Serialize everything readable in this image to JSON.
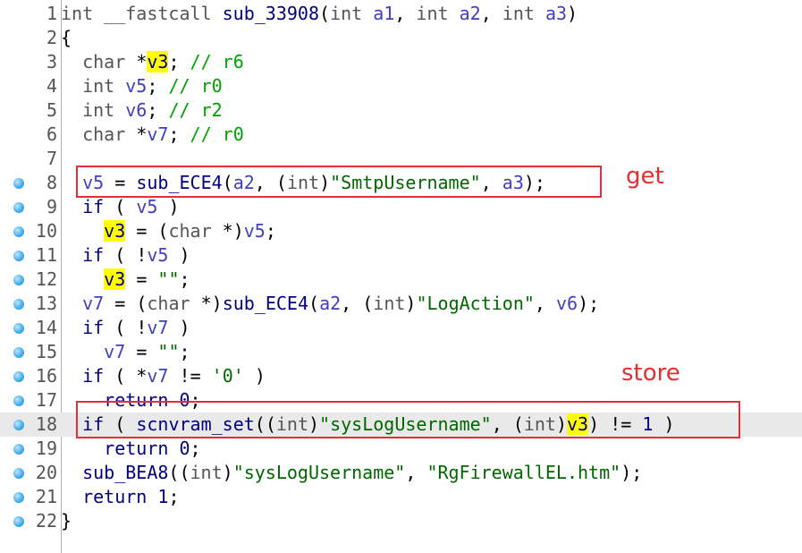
{
  "editor": {
    "lines": [
      {
        "num": "1",
        "bp": false,
        "hl": false,
        "code": "int __fastcall sub_33908(int a1, int a2, int a3)"
      },
      {
        "num": "2",
        "bp": false,
        "hl": false,
        "code": "{"
      },
      {
        "num": "3",
        "bp": false,
        "hl": false,
        "code": "  char *v3; // r6"
      },
      {
        "num": "4",
        "bp": false,
        "hl": false,
        "code": "  int v5; // r0"
      },
      {
        "num": "5",
        "bp": false,
        "hl": false,
        "code": "  int v6; // r2"
      },
      {
        "num": "6",
        "bp": false,
        "hl": false,
        "code": "  char *v7; // r0"
      },
      {
        "num": "7",
        "bp": false,
        "hl": false,
        "code": ""
      },
      {
        "num": "8",
        "bp": true,
        "hl": false,
        "code": "  v5 = sub_ECE4(a2, (int)\"SmtpUsername\", a3);"
      },
      {
        "num": "9",
        "bp": true,
        "hl": false,
        "code": "  if ( v5 )"
      },
      {
        "num": "10",
        "bp": true,
        "hl": false,
        "code": "    v3 = (char *)v5;"
      },
      {
        "num": "11",
        "bp": true,
        "hl": false,
        "code": "  if ( !v5 )"
      },
      {
        "num": "12",
        "bp": true,
        "hl": false,
        "code": "    v3 = \"\";"
      },
      {
        "num": "13",
        "bp": true,
        "hl": false,
        "code": "  v7 = (char *)sub_ECE4(a2, (int)\"LogAction\", v6);"
      },
      {
        "num": "14",
        "bp": true,
        "hl": false,
        "code": "  if ( !v7 )"
      },
      {
        "num": "15",
        "bp": true,
        "hl": false,
        "code": "    v7 = \"\";"
      },
      {
        "num": "16",
        "bp": true,
        "hl": false,
        "code": "  if ( *v7 != '0' )"
      },
      {
        "num": "17",
        "bp": true,
        "hl": false,
        "code": "    return 0;"
      },
      {
        "num": "18",
        "bp": true,
        "hl": true,
        "code": "  if ( scnvram_set((int)\"sysLogUsername\", (int)v3) != 1 )"
      },
      {
        "num": "19",
        "bp": true,
        "hl": false,
        "code": "    return 0;"
      },
      {
        "num": "20",
        "bp": true,
        "hl": false,
        "code": "  sub_BEA8((int)\"sysLogUsername\", \"RgFirewallEL.htm\");"
      },
      {
        "num": "21",
        "bp": true,
        "hl": false,
        "code": "  return 1;"
      },
      {
        "num": "22",
        "bp": true,
        "hl": false,
        "code": "}"
      }
    ]
  },
  "annotations": {
    "get_label": "get",
    "store_label": "store"
  },
  "colors": {
    "annotation": "#e03030",
    "highlight_variable": "#ffff00",
    "current_line": "#e9e9e9",
    "breakpoint": "#48b0f0"
  }
}
